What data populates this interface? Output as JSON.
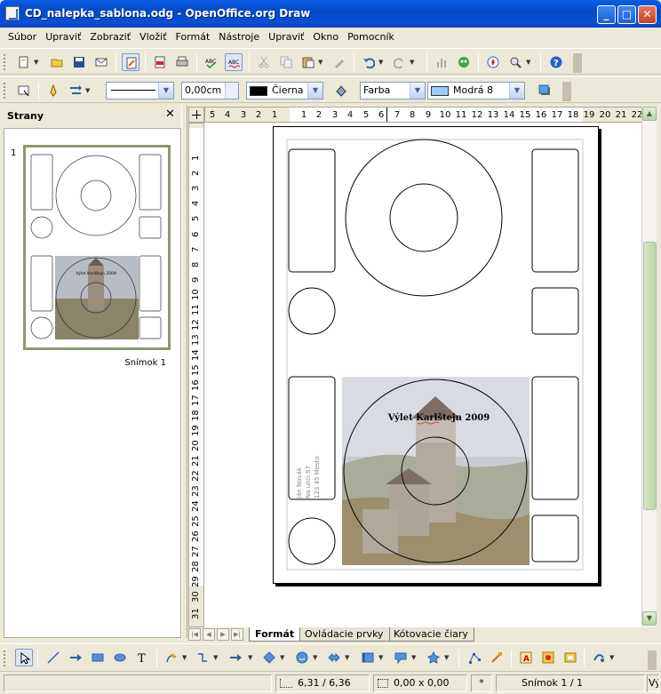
{
  "window": {
    "title": "CD_nalepka_sablona.odg - OpenOffice.org Draw",
    "min": "_",
    "max": "□",
    "close": "✕"
  },
  "menu": [
    "Súbor",
    "Upraviť",
    "Zobraziť",
    "Vložiť",
    "Formát",
    "Nástroje",
    "Upraviť",
    "Okno",
    "Pomocník"
  ],
  "line_props": {
    "width_value": "0,00cm",
    "line_color": "Čierna",
    "area_style": "Farba",
    "area_color": "Modrá 8"
  },
  "colors": {
    "line_color": "#000000",
    "area_color": "#99ccff",
    "accent": "#0a5fe6",
    "selection_green": "#8e9772"
  },
  "slides_panel": {
    "title": "Strany",
    "close": "✕",
    "slide_number": "1",
    "slide_label": "Snímok 1"
  },
  "hruler": {
    "labels": [
      "5",
      "4",
      "3",
      "2",
      "1",
      "1",
      "2",
      "3",
      "4",
      "5",
      "6",
      "7",
      "8",
      "9",
      "10",
      "11",
      "12",
      "13",
      "14",
      "15",
      "16",
      "17",
      "18",
      "19",
      "20",
      "21",
      "22",
      "2"
    ]
  },
  "vruler": {
    "labels": [
      "1",
      "2",
      "3",
      "4",
      "5",
      "6",
      "7",
      "8",
      "9",
      "10",
      "11",
      "12",
      "13",
      "14",
      "15",
      "16",
      "17",
      "18",
      "19",
      "20",
      "21",
      "22",
      "23",
      "24",
      "25",
      "26",
      "27",
      "28",
      "29",
      "30",
      "31"
    ]
  },
  "document": {
    "cd_title": "Výlet Karlštejn 2009",
    "address_lines": [
      "Ján Novák",
      "Na ulici 57",
      "123 45 Mesto"
    ],
    "thumb_title": "Výlet Karlštejn 2009"
  },
  "tabs": [
    "Formát",
    "Ovládacie prvky",
    "Kótovacie čiary"
  ],
  "status": {
    "position": "6,31 / 6,36",
    "size": "0,00 x 0,00",
    "modified": "*",
    "slide": "Snímok 1 / 1",
    "layout": "Vý"
  }
}
